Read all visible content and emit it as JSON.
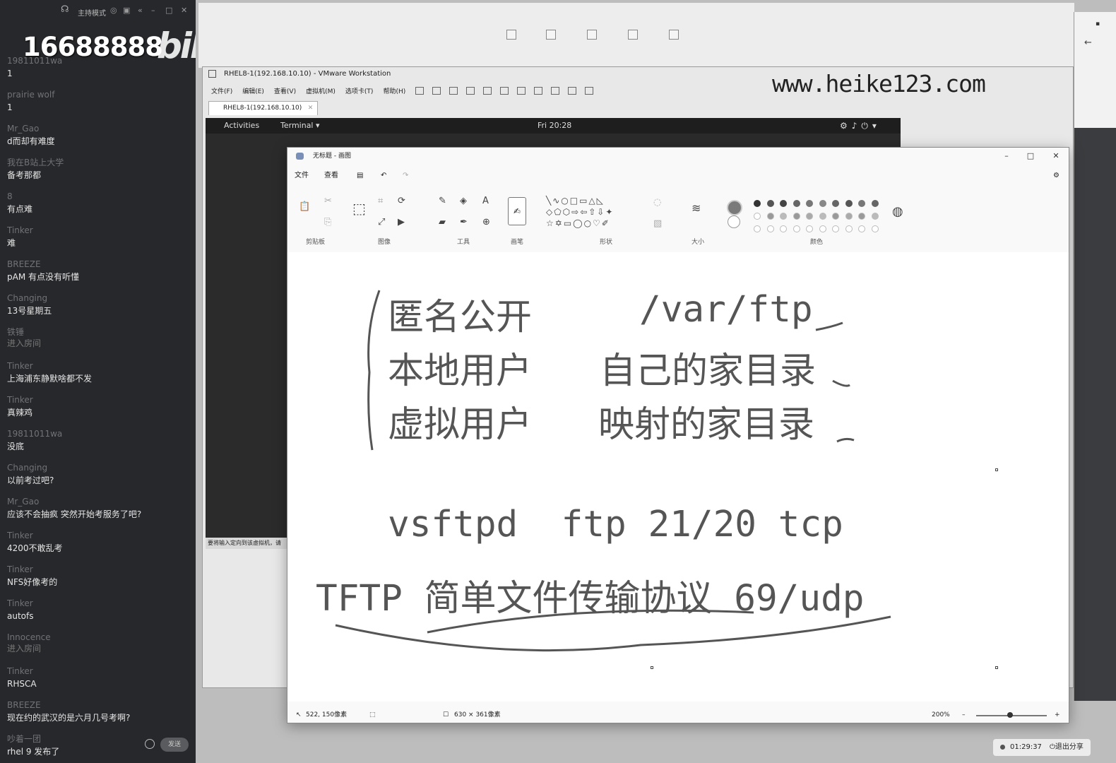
{
  "chat": {
    "host_mode": "主持模式",
    "big_number": "16688888",
    "logo": "bilibili",
    "send_label": "发送",
    "messages": [
      {
        "user": "19811011wa",
        "text": "1"
      },
      {
        "user": "prairie wolf",
        "text": "1"
      },
      {
        "user": "Mr_Gao",
        "text": "d而却有难度"
      },
      {
        "user": "我在B站上大学",
        "text": "备考那都"
      },
      {
        "user": "8",
        "text": "有点难"
      },
      {
        "user": "Tinker",
        "text": "难"
      },
      {
        "user": "BREEZE",
        "text": "pAM 有点没有听懂"
      },
      {
        "user": "Changing",
        "text": "13号星期五"
      },
      {
        "user": "铁锤",
        "enter": "进入房间",
        "text": ""
      },
      {
        "user": "Tinker",
        "text": "上海浦东静默啥都不发"
      },
      {
        "user": "Tinker",
        "text": "真辣鸡"
      },
      {
        "user": "19811011wa",
        "text": "没底"
      },
      {
        "user": "Changing",
        "text": "以前考过吧?"
      },
      {
        "user": "Mr_Gao",
        "text": "应该不会抽疯 突然开始考服务了吧?"
      },
      {
        "user": "Tinker",
        "text": "4200不敢乱考"
      },
      {
        "user": "Tinker",
        "text": "NFS好像考的"
      },
      {
        "user": "Tinker",
        "text": "autofs"
      },
      {
        "user": "Innocence",
        "enter": "进入房间",
        "text": ""
      },
      {
        "user": "Tinker",
        "text": "RHSCA"
      },
      {
        "user": "BREEZE",
        "text": "现在约的武汉的是六月几号考啊?"
      },
      {
        "user": "吵着一团",
        "text": "rhel 9 发布了"
      }
    ]
  },
  "watermark": "www.heike123.com",
  "vmware": {
    "title": "RHEL8-1(192.168.10.10) - VMware Workstation",
    "menu": [
      "文件(F)",
      "编辑(E)",
      "查看(V)",
      "虚拟机(M)",
      "选项卡(T)",
      "帮助(H)"
    ],
    "tab": "RHEL8-1(192.168.10.10)",
    "status": "要将输入定向到该虚拟机，请"
  },
  "gnome": {
    "activities": "Activities",
    "terminal": "Terminal",
    "clock": "Fri 20:28"
  },
  "paint": {
    "title": "无标题 - 画图",
    "menu": [
      "文件",
      "查看"
    ],
    "groups": [
      "剪贴板",
      "图像",
      "工具",
      "画笔",
      "形状",
      "大小",
      "颜色"
    ],
    "lines": {
      "row1_left": "匿名公开",
      "row1_right": "/var/ftp",
      "row2_left": "本地用户",
      "row2_right": "自己的家目录",
      "row3_left": "虚拟用户",
      "row3_right": "映射的家目录",
      "row4": "vsftpd  ftp 21/20 tcp",
      "row5_a": "TFTP ",
      "row5_b": "简单文件传输协议",
      "row5_c": " 69/udp"
    },
    "status_cursor": "522, 150像素",
    "status_size": "630 × 361像素",
    "zoom": "200%"
  },
  "session": {
    "time": "01:29:37",
    "exit_share": "退出分享"
  },
  "colors": {
    "chat_bg": "#27282b",
    "canvas_text": "#555555",
    "ink": "#555555"
  }
}
